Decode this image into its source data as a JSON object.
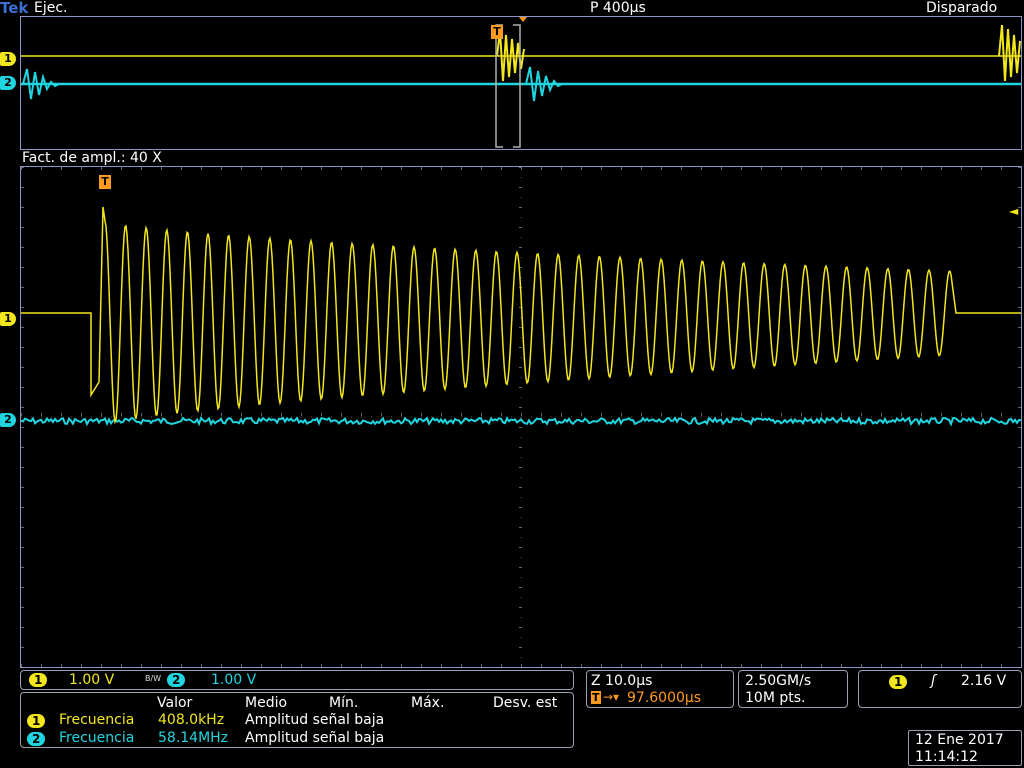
{
  "header": {
    "brand": "Tek",
    "run_state": "Ejec.",
    "timebase": "P 400µs",
    "trigger_status": "Disparado"
  },
  "zoom_label": "Fact. de ampl.: 40 X",
  "channels": [
    {
      "id": "1",
      "color": "#f2e61c",
      "scale": "1.00 V"
    },
    {
      "id": "2",
      "color": "#1fd6e0",
      "scale": "1.00 V"
    }
  ],
  "bandwidth_icon": "B/W",
  "trigger_marker": "T",
  "zoom_box": {
    "time": "Z 10.0µs",
    "delay": "97.6000µs",
    "delay_icon": "T-arrow-icon"
  },
  "acquisition": {
    "sample_rate": "2.50GM/s",
    "record_length": "10M pts."
  },
  "trigger": {
    "channel": "1",
    "slope_icon": "rising-edge-icon",
    "level": "2.16 V"
  },
  "measurements": {
    "headers": [
      "Valor",
      "Medio",
      "Mín.",
      "Máx.",
      "Desv. est"
    ],
    "rows": [
      {
        "channel": "1",
        "name": "Frecuencia",
        "value": "408.0kHz",
        "note": "Amplitud señal baja",
        "color": "#f2e61c"
      },
      {
        "channel": "2",
        "name": "Frecuencia",
        "value": "58.14MHz",
        "note": "Amplitud señal baja",
        "color": "#1fd6e0"
      }
    ]
  },
  "datetime": {
    "date": "12 Ene  2017",
    "time": "11:14:12"
  }
}
